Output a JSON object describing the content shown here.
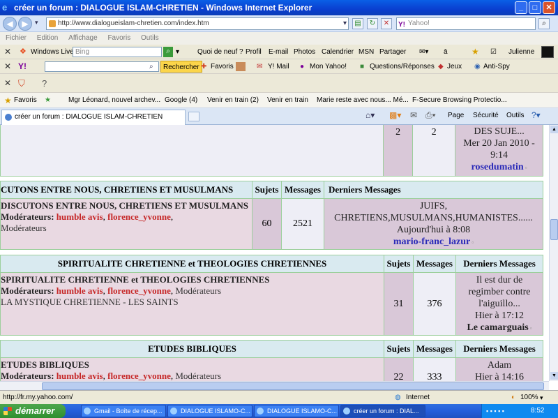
{
  "window": {
    "title": "créer un forum : DIALOGUE ISLAM-CHRETIEN - Windows Internet Explorer",
    "minimize": "_",
    "maximize": "□",
    "close": "✕"
  },
  "address": {
    "url": "http://www.dialogueislam-chretien.com/index.htm",
    "search_placeholder": "Yahoo!",
    "search_brand": "Y!"
  },
  "menu": [
    "Fichier",
    "Edition",
    "Affichage",
    "Favoris",
    "Outils"
  ],
  "windows_live_bar": {
    "brand": "Windows Live",
    "search_placeholder": "Bing",
    "links": [
      "Quoi de neuf ?",
      "Profil",
      "E-mail",
      "Photos",
      "Calendrier",
      "MSN",
      "Partager"
    ],
    "user": "Julienne"
  },
  "yahoo_bar": {
    "brand": "Y!",
    "search_button": "Rechercher",
    "items": [
      "Favoris",
      "Y! Mail",
      "Mon Yahoo!",
      "Questions/Réponses",
      "Jeux",
      "Anti-Spy"
    ]
  },
  "favorites_bar": {
    "label": "Favoris",
    "links": [
      "Mgr Léonard, nouvel archev...",
      "Google (4)",
      "Venir en train (2)",
      "Venir en train",
      "Marie reste avec nous... Mé...",
      "F-Secure Browsing Protectio..."
    ]
  },
  "tab": {
    "title": "créer un forum : DIALOGUE ISLAM-CHRETIEN"
  },
  "command_bar": [
    "Page",
    "Sécurité",
    "Outils"
  ],
  "forum": {
    "top_row": {
      "sujets": "2",
      "messages": "2",
      "last_lines": [
        "DES SUJE...",
        "Mer 20 Jan 2010 -",
        "9:14"
      ],
      "last_user": "rosedumatin"
    },
    "section1": {
      "header": "CUTONS ENTRE NOUS, CHRETIENS ET MUSULMANS",
      "col_sujets": "Sujets",
      "col_messages": "Messages",
      "col_last": "Derniers Messages",
      "forum_name": "DISCUTONS ENTRE NOUS, CHRETIENS ET MUSULMANS",
      "mod_label": "Modérateurs:",
      "mod1": "humble avis",
      "mod2": "florence_yvonne",
      "mod_group": "Modérateurs",
      "sujets": "60",
      "messages": "2521",
      "last_lines": [
        "JUIFS,",
        "CHRETIENS,MUSULMANS,HUMANISTES......",
        "Aujourd'hui à 8:08"
      ],
      "last_user": "mario-franc_lazur"
    },
    "section2": {
      "header": "SPIRITUALITE CHRETIENNE et THEOLOGIES CHRETIENNES",
      "col_sujets": "Sujets",
      "col_messages": "Messages",
      "col_last": "Derniers Messages",
      "forum_name": "SPIRITUALITE CHRETIENNE et THEOLOGIES CHRETIENNES",
      "mod_label": "Modérateurs:",
      "mod1": "humble avis",
      "mod2": "florence_yvonne",
      "mod_group": "Modérateurs",
      "subforum": "LA MYSTIQUE CHRETIENNE - LES SAINTS",
      "sujets": "31",
      "messages": "376",
      "last_lines": [
        "Il est dur de",
        "regimber contre",
        "l'aiguillo...",
        "Hier à 17:12"
      ],
      "last_user": "Le camarguais"
    },
    "section3": {
      "header": "ETUDES BIBLIQUES",
      "col_sujets": "Sujets",
      "col_messages": "Messages",
      "col_last": "Derniers Messages",
      "forum_name": "ETUDES BIBLIQUES",
      "mod_label": "Modérateurs:",
      "mod1": "humble avis",
      "mod2": "florence_yvonne",
      "mod_group": "Modérateurs",
      "sujets": "22",
      "messages": "333",
      "last_lines": [
        "Adam",
        "Hier à 14:16"
      ]
    }
  },
  "status": {
    "url": "http://fr.my.yahoo.com/",
    "zone": "Internet",
    "zoom": "100%"
  },
  "taskbar": {
    "start": "démarrer",
    "tasks": [
      "Gmail - Boîte de récep...",
      "DIALOGUE ISLAMO-C...",
      "DIALOGUE ISLAMO-C...",
      "créer un forum : DIAL..."
    ],
    "clock": "8:52"
  }
}
